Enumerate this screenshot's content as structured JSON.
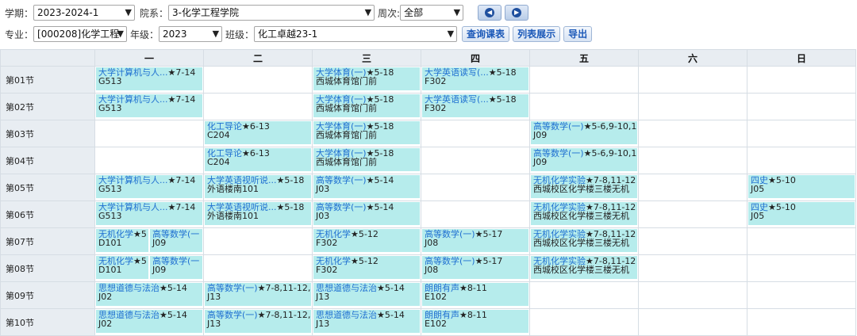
{
  "filters": {
    "term_label": "学期：",
    "term_value": "2023-2024-1",
    "dept_label": "院系：",
    "dept_value": "3-化学工程学院",
    "week_label": "周次:",
    "week_value": "全部",
    "major_label": "专业：",
    "major_value": "[000208]化学工程",
    "grade_label": "年级：",
    "grade_value": "2023",
    "class_label": "班级：",
    "class_value": "化工卓越23-1",
    "query_button": "查询课表",
    "list_button": "列表展示",
    "export_button": "导出"
  },
  "grid": {
    "days": [
      "一",
      "二",
      "三",
      "四",
      "五",
      "六",
      "日"
    ],
    "periods": [
      "第01节",
      "第02节",
      "第03节",
      "第04节",
      "第05节",
      "第06节",
      "第07节",
      "第08节",
      "第09节",
      "第10节"
    ],
    "cells": {
      "r1": {
        "d1": {
          "title": "大学计算机与人...",
          "weeks": "★7-14",
          "room": "G513"
        },
        "d3": {
          "title": "大学体育(一)",
          "weeks": "★5-18",
          "room": "西城体育馆门前"
        },
        "d4": {
          "title": "大学英语读写(...",
          "weeks": "★5-18",
          "room": "F302"
        }
      },
      "r2": {
        "d1": {
          "title": "大学计算机与人...",
          "weeks": "★7-14",
          "room": "G513"
        },
        "d3": {
          "title": "大学体育(一)",
          "weeks": "★5-18",
          "room": "西城体育馆门前"
        },
        "d4": {
          "title": "大学英语读写(...",
          "weeks": "★5-18",
          "room": "F302"
        }
      },
      "r3": {
        "d2": {
          "title": "化工导论",
          "weeks": "★6-13",
          "room": "C204"
        },
        "d3": {
          "title": "大学体育(一)",
          "weeks": "★5-18",
          "room": "西城体育馆门前"
        },
        "d5": {
          "title": "高等数学(一)",
          "weeks": "★5-6,9-10,1",
          "room": "J09"
        }
      },
      "r4": {
        "d2": {
          "title": "化工导论",
          "weeks": "★6-13",
          "room": "C204"
        },
        "d3": {
          "title": "大学体育(一)",
          "weeks": "★5-18",
          "room": "西城体育馆门前"
        },
        "d5": {
          "title": "高等数学(一)",
          "weeks": "★5-6,9-10,1",
          "room": "J09"
        }
      },
      "r5": {
        "d1": {
          "title": "大学计算机与人...",
          "weeks": "★7-14",
          "room": "G513"
        },
        "d2": {
          "title": "大学英语视听说...",
          "weeks": "★5-18",
          "room": "外语楼南101"
        },
        "d3": {
          "title": "高等数学(一)",
          "weeks": "★5-14",
          "room": "J03"
        },
        "d5": {
          "title": "无机化学实验",
          "weeks": "★7-8,11-12",
          "room": "西城校区化学楼三楼无机"
        },
        "d7": {
          "title": "四史",
          "weeks": "★5-10",
          "room": "J05"
        }
      },
      "r6": {
        "d1": {
          "title": "大学计算机与人...",
          "weeks": "★7-14",
          "room": "G513"
        },
        "d2": {
          "title": "大学英语视听说...",
          "weeks": "★5-18",
          "room": "外语楼南101"
        },
        "d3": {
          "title": "高等数学(一)",
          "weeks": "★5-14",
          "room": "J03"
        },
        "d5": {
          "title": "无机化学实验",
          "weeks": "★7-8,11-12",
          "room": "西城校区化学楼三楼无机"
        },
        "d7": {
          "title": "四史",
          "weeks": "★5-10",
          "room": "J05"
        }
      },
      "r7": {
        "d1a": {
          "title": "无机化学",
          "weeks": "★5",
          "room": "D101"
        },
        "d1b": {
          "title": "高等数学(一",
          "weeks": "",
          "room": "J09"
        },
        "d3": {
          "title": "无机化学",
          "weeks": "★5-12",
          "room": "F302"
        },
        "d4": {
          "title": "高等数学(一)",
          "weeks": "★5-17",
          "room": "J08"
        },
        "d5": {
          "title": "无机化学实验",
          "weeks": "★7-8,11-12",
          "room": "西城校区化学楼三楼无机"
        }
      },
      "r8": {
        "d1a": {
          "title": "无机化学",
          "weeks": "★5",
          "room": "D101"
        },
        "d1b": {
          "title": "高等数学(一",
          "weeks": "",
          "room": "J09"
        },
        "d3": {
          "title": "无机化学",
          "weeks": "★5-12",
          "room": "F302"
        },
        "d4": {
          "title": "高等数学(一)",
          "weeks": "★5-17",
          "room": "J08"
        },
        "d5": {
          "title": "无机化学实验",
          "weeks": "★7-8,11-12",
          "room": "西城校区化学楼三楼无机"
        }
      },
      "r9": {
        "d1": {
          "title": "思想道德与法治",
          "weeks": "★5-14",
          "room": "J02"
        },
        "d2": {
          "title": "高等数学(一)",
          "weeks": "★7-8,11-12,",
          "room": "J13"
        },
        "d3": {
          "title": "思想道德与法治",
          "weeks": "★5-14",
          "room": "J13"
        },
        "d4": {
          "title": "朗朗有声",
          "weeks": "★8-11",
          "room": "E102"
        }
      },
      "r10": {
        "d1": {
          "title": "思想道德与法治",
          "weeks": "★5-14",
          "room": "J02"
        },
        "d2": {
          "title": "高等数学(一)",
          "weeks": "★7-8,11-12,",
          "room": "J13"
        },
        "d3": {
          "title": "思想道德与法治",
          "weeks": "★5-14",
          "room": "J13"
        },
        "d4": {
          "title": "朗朗有声",
          "weeks": "★8-11",
          "room": "E102"
        }
      }
    }
  }
}
